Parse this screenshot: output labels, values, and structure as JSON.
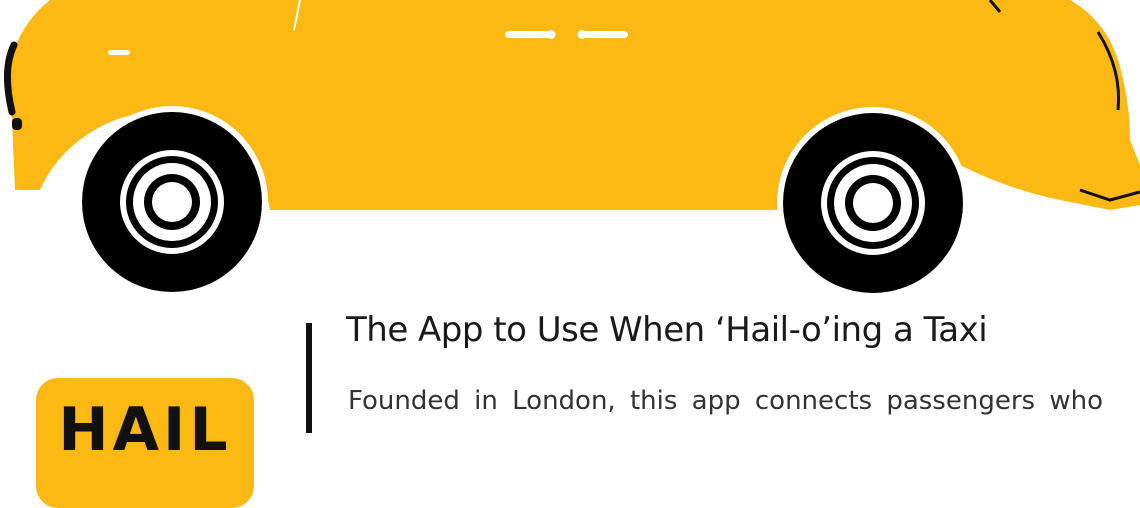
{
  "hero": {
    "illustration_icon": "taxi-icon",
    "body_color": "#fdb913",
    "tire_color": "#000000"
  },
  "app_icon": {
    "text": "HAIL",
    "background": "#fdb913"
  },
  "article": {
    "title": "The App to Use When ‘Hail-o’ing a Taxi",
    "body": "Founded in London, this app connects passengers who"
  }
}
